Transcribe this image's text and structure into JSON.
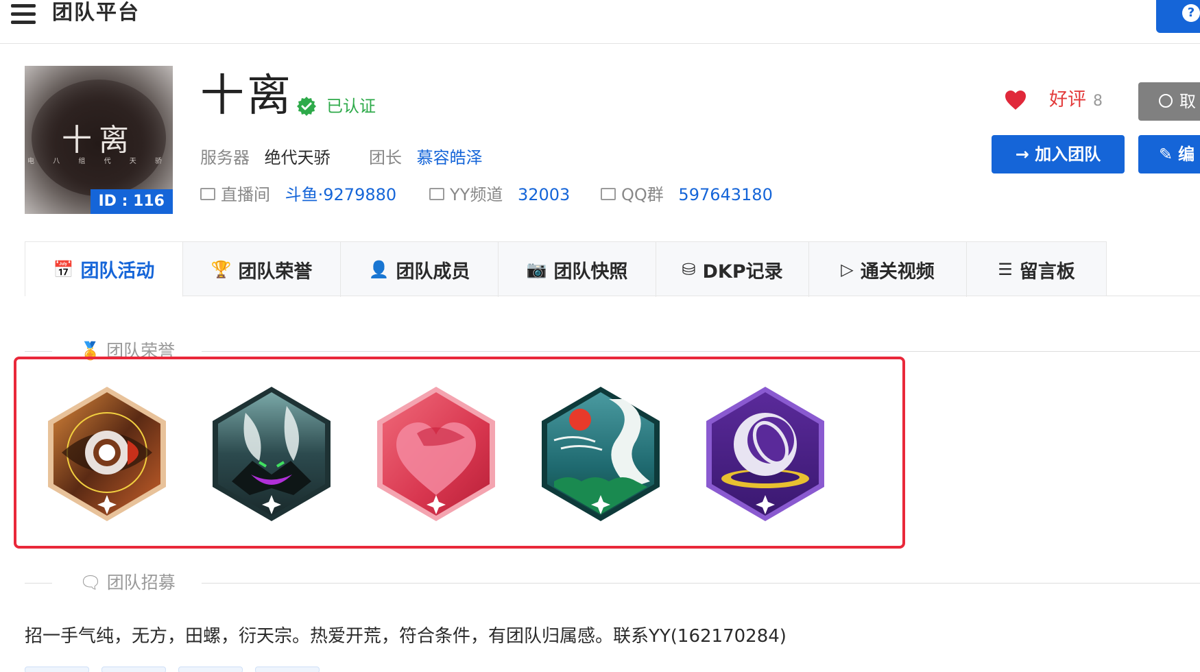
{
  "header": {
    "title": "团队平台",
    "help": "?"
  },
  "team": {
    "name": "十离",
    "verified_label": "已认证",
    "avatar_text": "十离",
    "avatar_sub": "电 八 组 代 天 骄",
    "id_label": "ID : 116"
  },
  "meta": {
    "server_label": "服务器",
    "server_value": "绝代天骄",
    "leader_label": "团长",
    "leader_value": "慕容皓泽",
    "live_label": "直播间",
    "live_value": "斗鱼·9279880",
    "yy_label": "YY频道",
    "yy_value": "32003",
    "qq_label": "QQ群",
    "qq_value": "597643180"
  },
  "actions": {
    "like_label": "好评",
    "like_count": "8",
    "cancel_label": "取",
    "join_label": "→ 加入团队",
    "edit_label": "编"
  },
  "tabs": [
    {
      "icon": "📅",
      "label": "团队活动"
    },
    {
      "icon": "🏆",
      "label": "团队荣誉"
    },
    {
      "icon": "👤",
      "label": "团队成员"
    },
    {
      "icon": "📷",
      "label": "团队快照"
    },
    {
      "icon": "⛁",
      "label": "DKP记录"
    },
    {
      "icon": "▷",
      "label": "通关视频"
    },
    {
      "icon": "☰",
      "label": "留言板"
    }
  ],
  "sections": {
    "honors_title": "团队荣誉",
    "recruit_title": "团队招募"
  },
  "honors": [
    {
      "name": "eye-badge",
      "color": "#8a4a22"
    },
    {
      "name": "beast-badge",
      "color": "#2c4a4e"
    },
    {
      "name": "heart-badge",
      "color": "#d8364f"
    },
    {
      "name": "wave-badge",
      "color": "#1f6a70"
    },
    {
      "name": "orb-badge",
      "color": "#5a2a9a"
    }
  ],
  "recruit": {
    "text": "招一手气纯，无方，田螺，衍天宗。热爱开荒，符合条件，有团队归属感。联系YY(162170284)"
  },
  "colors": {
    "accent": "#1565d8",
    "verified": "#2eaa4a",
    "like": "#e33a3a",
    "highlight": "#e9283a"
  }
}
